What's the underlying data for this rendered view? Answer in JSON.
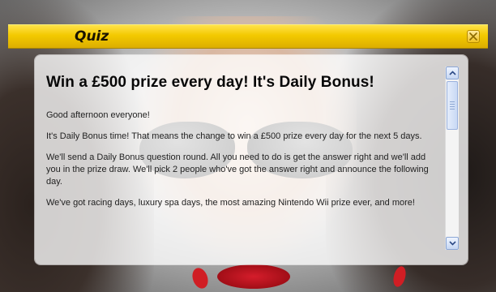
{
  "window": {
    "title": "Quiz",
    "close_icon": "close-icon"
  },
  "panel": {
    "headline": "Win a £500 prize every day! It's Daily Bonus!",
    "paragraphs": [
      "Good afternoon everyone!",
      "It's Daily Bonus time!  That means the change to win a £500 prize every day for the next 5 days.",
      "We'll send a Daily Bonus question round. All you need to do is get the answer right and we'll add you in the prize draw.  We'll pick 2 people who've got the answer right and announce the following day.",
      "We've got racing days, luxury spa days, the most amazing Nintendo Wii prize ever, and more!"
    ]
  },
  "colors": {
    "titlebar": "#f3c900",
    "title_text": "#1a1300"
  }
}
